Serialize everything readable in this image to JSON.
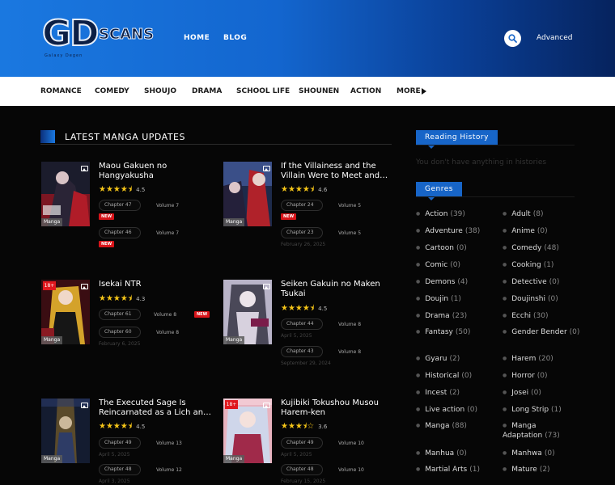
{
  "brand": {
    "logo_main": "GD",
    "logo_sub": "SCANS",
    "logo_tag": "Galaxy Degen"
  },
  "topnav": {
    "home": "HOME",
    "blog": "BLOG",
    "advanced": "Advanced"
  },
  "genre_bar": [
    "ROMANCE",
    "COMEDY",
    "SHOUJO",
    "DRAMA",
    "SCHOOL LIFE",
    "SHOUNEN",
    "ACTION",
    "MORE"
  ],
  "section": {
    "latest_title": "LATEST MANGA UPDATES"
  },
  "cards": [
    {
      "title": "Maou Gakuen no Hangyakusha",
      "stars": "★★★★⯨",
      "rating": "4.5",
      "type": "Manga",
      "ch1": "Chapter 47",
      "v1": "Volume 7",
      "ch2": "Chapter 46",
      "v2": "Volume 7",
      "new_label": "NEW"
    },
    {
      "title": "If the Villainess and the Villain Were to Meet and…",
      "stars": "★★★★⯨",
      "rating": "4.6",
      "type": "Manga",
      "ch1": "Chapter 24",
      "v1": "Volume 5",
      "ch2": "Chapter 23",
      "v2": "Volume 5",
      "date2": "February 26, 2025",
      "new_label": "NEW"
    },
    {
      "title": "Isekai NTR",
      "stars": "★★★★⯨",
      "rating": "4.3",
      "type": "Manga",
      "adult": "18+",
      "ch1": "Chapter 61",
      "v1": "Volume 8",
      "ch2": "Chapter 60",
      "v2": "Volume 8",
      "date2": "February 6, 2025",
      "new_label": "NEW"
    },
    {
      "title": "Seiken Gakuin no Maken Tsukai",
      "stars": "★★★★⯨",
      "rating": "4.5",
      "type": "Manga",
      "ch1": "Chapter 44",
      "v1": "Volume 8",
      "date1": "April 5, 2025",
      "ch2": "Chapter 43",
      "v2": "Volume 8",
      "date2": "September 29, 2024"
    },
    {
      "title": "The Executed Sage Is Reincarnated as a Lich an…",
      "stars": "★★★★⯨",
      "rating": "4.5",
      "type": "Manga",
      "ch1": "Chapter 49",
      "v1": "Volume 13",
      "date1": "April 5, 2025",
      "ch2": "Chapter 48",
      "v2": "Volume 12",
      "date2": "April 3, 2025"
    },
    {
      "title": "Kujibiki Tokushou Musou Harem-ken",
      "stars": "★★★⯨☆",
      "rating": "3.6",
      "type": "Manga",
      "adult": "18+",
      "ch1": "Chapter 49",
      "v1": "Volume 10",
      "date1": "April 5, 2025",
      "ch2": "Chapter 48",
      "v2": "Volume 10",
      "date2": "February 15, 2025"
    }
  ],
  "sidebar": {
    "history_title": "Reading History",
    "history_empty": "You don't have anything in histories",
    "genres_title": "Genres",
    "genres": [
      {
        "name": "Action",
        "count": "(39)"
      },
      {
        "name": "Adult",
        "count": "(8)"
      },
      {
        "name": "Adventure",
        "count": "(38)"
      },
      {
        "name": "Anime",
        "count": "(0)"
      },
      {
        "name": "Cartoon",
        "count": "(0)"
      },
      {
        "name": "Comedy",
        "count": "(48)"
      },
      {
        "name": "Comic",
        "count": "(0)"
      },
      {
        "name": "Cooking",
        "count": "(1)"
      },
      {
        "name": "Demons",
        "count": "(4)"
      },
      {
        "name": "Detective",
        "count": "(0)"
      },
      {
        "name": "Doujin",
        "count": "(1)"
      },
      {
        "name": "Doujinshi",
        "count": "(0)"
      },
      {
        "name": "Drama",
        "count": "(23)"
      },
      {
        "name": "Ecchi",
        "count": "(30)"
      },
      {
        "name": "Fantasy",
        "count": "(50)"
      },
      {
        "name": "Gender Bender",
        "count": "(0)"
      },
      {
        "name": "Gyaru",
        "count": "(2)"
      },
      {
        "name": "Harem",
        "count": "(20)"
      },
      {
        "name": "Historical",
        "count": "(0)"
      },
      {
        "name": "Horror",
        "count": "(0)"
      },
      {
        "name": "Incest",
        "count": "(2)"
      },
      {
        "name": "Josei",
        "count": "(0)"
      },
      {
        "name": "Live action",
        "count": "(0)"
      },
      {
        "name": "Long Strip",
        "count": "(1)"
      },
      {
        "name": "Manga",
        "count": "(88)"
      },
      {
        "name": "Manga Adaptation",
        "count": "(73)"
      },
      {
        "name": "Manhua",
        "count": "(0)"
      },
      {
        "name": "Manhwa",
        "count": "(0)"
      },
      {
        "name": "Martial Arts",
        "count": "(1)"
      },
      {
        "name": "Mature",
        "count": "(2)"
      }
    ]
  },
  "colors": {
    "header_start": "#1a78e0",
    "header_end": "#06235e",
    "accent": "#1765c8",
    "star": "#f5c518",
    "new_badge": "#d8141a",
    "adult_badge": "#e0181e"
  }
}
